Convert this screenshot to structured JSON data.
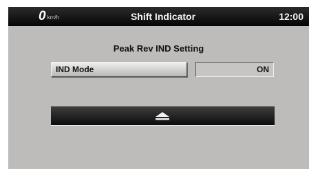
{
  "header": {
    "speed_value": "0",
    "speed_unit": "km/h",
    "title": "Shift Indicator",
    "clock": "12:00"
  },
  "main": {
    "section_title": "Peak Rev IND Setting",
    "setting": {
      "label": "IND Mode",
      "value": "ON"
    },
    "eject_button": {
      "icon": "eject-icon"
    }
  },
  "colors": {
    "panel_background": "#bdbcba",
    "header_background": "#050505",
    "header_text": "#f4f4f4",
    "eject_bar": "#0c0c0c"
  }
}
